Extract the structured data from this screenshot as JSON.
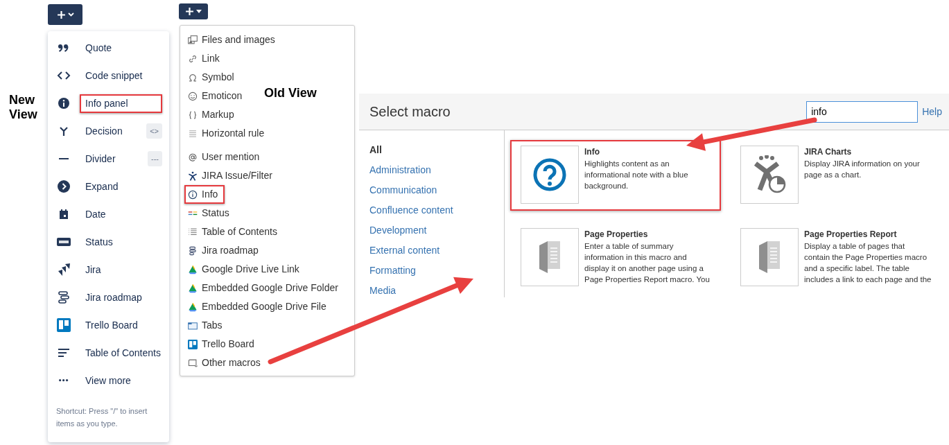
{
  "new_view": {
    "label": "New View",
    "items": [
      {
        "label": "Quote",
        "highlighted": false
      },
      {
        "label": "Code snippet",
        "highlighted": false
      },
      {
        "label": "Info panel",
        "highlighted": true
      },
      {
        "label": "Decision",
        "shortcut": "<>",
        "highlighted": false
      },
      {
        "label": "Divider",
        "shortcut": "---",
        "highlighted": false
      },
      {
        "label": "Expand",
        "highlighted": false
      },
      {
        "label": "Date",
        "highlighted": false
      },
      {
        "label": "Status",
        "highlighted": false
      },
      {
        "label": "Jira",
        "highlighted": false
      },
      {
        "label": "Jira roadmap",
        "highlighted": false
      },
      {
        "label": "Trello Board",
        "highlighted": false
      },
      {
        "label": "Table of Contents",
        "highlighted": false
      },
      {
        "label": "View more",
        "highlighted": false
      }
    ],
    "footer": "Shortcut: Press \"/\" to insert items as you type."
  },
  "old_view": {
    "label": "Old View",
    "groups": [
      [
        {
          "label": "Files and images",
          "highlighted": false
        },
        {
          "label": "Link",
          "highlighted": false
        },
        {
          "label": "Symbol",
          "highlighted": false
        },
        {
          "label": "Emoticon",
          "highlighted": false
        },
        {
          "label": "Markup",
          "highlighted": false
        },
        {
          "label": "Horizontal rule",
          "highlighted": false
        }
      ],
      [
        {
          "label": "User mention",
          "highlighted": false
        },
        {
          "label": "JIRA Issue/Filter",
          "highlighted": false
        },
        {
          "label": "Info",
          "highlighted": true
        },
        {
          "label": "Status",
          "highlighted": false
        },
        {
          "label": "Table of Contents",
          "highlighted": false
        },
        {
          "label": "Jira roadmap",
          "highlighted": false
        },
        {
          "label": "Google Drive Live Link",
          "highlighted": false
        },
        {
          "label": "Embedded Google Drive Folder",
          "highlighted": false
        },
        {
          "label": "Embedded Google Drive File",
          "highlighted": false
        },
        {
          "label": "Tabs",
          "highlighted": false
        },
        {
          "label": "Trello Board",
          "highlighted": false
        },
        {
          "label": "Other macros",
          "highlighted": false
        }
      ]
    ]
  },
  "dialog": {
    "title": "Select macro",
    "search": {
      "value": "info"
    },
    "help": "Help",
    "categories": [
      {
        "label": "All",
        "selected": true
      },
      {
        "label": "Administration",
        "selected": false
      },
      {
        "label": "Communication",
        "selected": false
      },
      {
        "label": "Confluence content",
        "selected": false
      },
      {
        "label": "Development",
        "selected": false
      },
      {
        "label": "External content",
        "selected": false
      },
      {
        "label": "Formatting",
        "selected": false
      },
      {
        "label": "Media",
        "selected": false
      }
    ],
    "macros": [
      {
        "title": "Info",
        "description": "Highlights content as an informational note with a blue background.",
        "highlighted": true
      },
      {
        "title": "JIRA Charts",
        "description": "Display JIRA information on your page as a chart.",
        "highlighted": false
      },
      {
        "title": "Page Properties",
        "description": "Enter a table of summary information in this macro and display it on another page using a Page Properties Report macro. You",
        "highlighted": false
      },
      {
        "title": "Page Properties Report",
        "description": "Display a table of pages that contain the Page Properties macro and a specific label. The table includes a link to each page and the",
        "highlighted": false
      }
    ]
  }
}
